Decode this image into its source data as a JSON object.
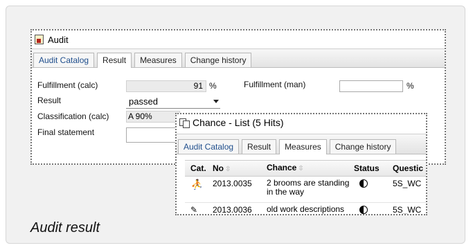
{
  "audit_window": {
    "title": "Audit",
    "tabs": [
      "Audit Catalog",
      "Result",
      "Measures",
      "Change history"
    ],
    "active_tab": "Result",
    "fields": {
      "fulfillment_calc_label": "Fulfillment (calc)",
      "fulfillment_calc_value": "91",
      "fulfillment_calc_unit": "%",
      "fulfillment_man_label": "Fulfillment (man)",
      "fulfillment_man_value": "",
      "fulfillment_man_unit": "%",
      "result_label": "Result",
      "result_value": "passed",
      "classification_label": "Classification (calc)",
      "classification_value": "A 90%",
      "final_statement_label": "Final statement",
      "final_statement_value": ""
    }
  },
  "chance_window": {
    "title": "Chance - List (5 Hits)",
    "tabs": [
      "Audit Catalog",
      "Result",
      "Measures",
      "Change history"
    ],
    "active_tab": "Measures",
    "columns": [
      "Cat.",
      "No",
      "Chance",
      "Status",
      "Questic"
    ],
    "rows": [
      {
        "cat_icon": "runner-icon",
        "no": "2013.0035",
        "chance": "2 brooms are standing in the way",
        "status_icon": "half-circle-icon",
        "question": "5S_WC"
      },
      {
        "cat_icon": "tag-icon",
        "no": "2013.0036",
        "chance": "old work descriptions",
        "status_icon": "half-circle-icon",
        "question": "5S_WC"
      }
    ]
  },
  "caption": "Audit result"
}
